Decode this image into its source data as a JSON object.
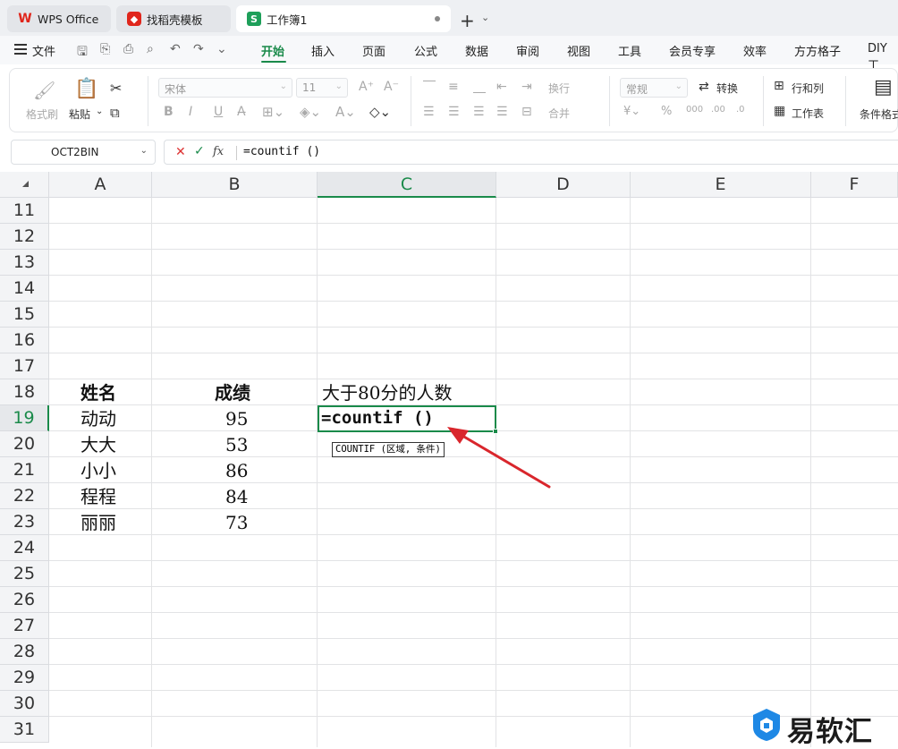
{
  "tabs": [
    {
      "label": "WPS Office"
    },
    {
      "label": "找稻壳模板"
    },
    {
      "label": "工作簿1"
    }
  ],
  "menu": {
    "file": "文件",
    "items": [
      "开始",
      "插入",
      "页面",
      "公式",
      "数据",
      "审阅",
      "视图",
      "工具",
      "会员专享",
      "效率",
      "方方格子",
      "DIY工"
    ],
    "active_index": 0
  },
  "ribbon": {
    "format_painter": "格式刷",
    "paste": "粘贴",
    "font_name": "宋体",
    "font_size": "11",
    "wrap": "换行",
    "merge": "合并",
    "number_format": "常规",
    "convert": "转换",
    "rows_cols": "行和列",
    "worksheet": "工作表",
    "conditional": "条件格式"
  },
  "formula_bar": {
    "name_box": "OCT2BIN",
    "formula": "=countif ()"
  },
  "columns": [
    "A",
    "B",
    "C",
    "D",
    "E",
    "F"
  ],
  "selected_column": "C",
  "rows": [
    "11",
    "12",
    "13",
    "14",
    "15",
    "16",
    "17",
    "18",
    "19",
    "20",
    "21",
    "22",
    "23",
    "24",
    "25",
    "26",
    "27",
    "28",
    "29",
    "30",
    "31"
  ],
  "selected_row": "19",
  "cells": {
    "A18": "姓名",
    "B18": "成绩",
    "C18": "大于80分的人数",
    "A19": "动动",
    "B19": "95",
    "A20": "大大",
    "B20": "53",
    "A21": "小小",
    "B21": "86",
    "A22": "程程",
    "B22": "84",
    "A23": "丽丽",
    "B23": "73"
  },
  "editing": {
    "cell": "C19",
    "text": "=countif ()",
    "tooltip": "COUNTIF (区域, 条件)"
  },
  "watermark": "易软汇",
  "colors": {
    "accent": "#1a8a4a",
    "arrow": "#d9262c"
  }
}
